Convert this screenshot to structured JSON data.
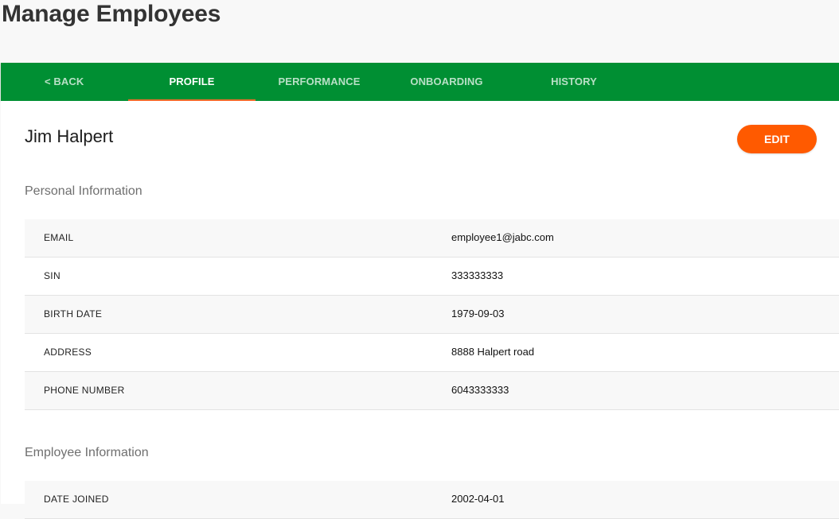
{
  "page": {
    "title": "Manage Employees"
  },
  "tabs": {
    "back": "< BACK",
    "profile": "PROFILE",
    "performance": "PERFORMANCE",
    "onboarding": "ONBOARDING",
    "history": "HISTORY",
    "active": "profile"
  },
  "profile": {
    "name": "Jim Halpert",
    "edit_label": "EDIT"
  },
  "personal_info": {
    "heading": "Personal Information",
    "rows": [
      {
        "label": "EMAIL",
        "value": "employee1@jabc.com"
      },
      {
        "label": "SIN",
        "value": "333333333"
      },
      {
        "label": "BIRTH DATE",
        "value": "1979-09-03"
      },
      {
        "label": "ADDRESS",
        "value": "8888 Halpert road"
      },
      {
        "label": "PHONE NUMBER",
        "value": "6043333333"
      }
    ]
  },
  "employee_info": {
    "heading": "Employee Information",
    "rows": [
      {
        "label": "DATE JOINED",
        "value": "2002-04-01"
      }
    ]
  },
  "colors": {
    "tabbar": "#008f33",
    "tab_indicator": "#f06a2a",
    "edit_button": "#ff5a00"
  }
}
